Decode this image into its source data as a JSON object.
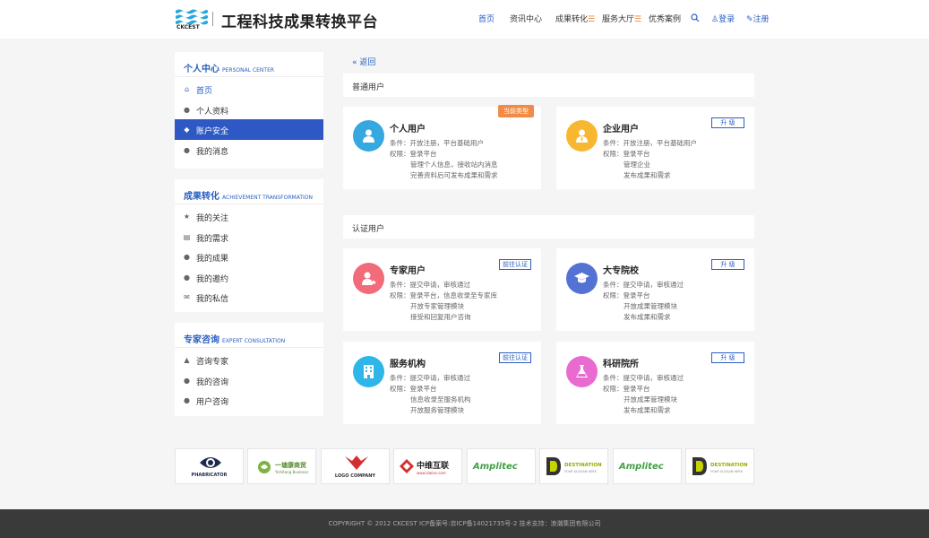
{
  "header": {
    "logo_text": "CKCEST",
    "site_title": "工程科技成果转换平台",
    "nav": {
      "home": "首页",
      "news": "资讯中心",
      "achievement": "成果转化",
      "service": "服务大厅",
      "cases": "优秀案例",
      "login": "登录",
      "register": "注册"
    }
  },
  "sidebar": {
    "personal": {
      "title": "个人中心",
      "subtitle": "PERSONAL CENTER",
      "items": [
        "首页",
        "个人资料",
        "账户安全",
        "我的消息"
      ]
    },
    "achievement": {
      "title": "成果转化",
      "subtitle": "ACHIEVEMENT TRANSFORMATION",
      "items": [
        "我的关注",
        "我的需求",
        "我的成果",
        "我的邀约",
        "我的私信"
      ]
    },
    "expert": {
      "title": "专家咨询",
      "subtitle": "EXPERT CONSULTATION",
      "items": [
        "咨询专家",
        "我的咨询",
        "用户咨询"
      ]
    }
  },
  "main": {
    "back": "返回",
    "regular_section": "普通用户",
    "certified_section": "认证用户",
    "cards": {
      "personal": {
        "title": "个人用户",
        "badge": "当前类型",
        "lines": [
          "条件：开放注册，平台基础用户",
          "权限：登录平台",
          "管理个人信息，接收站内消息",
          "完善资料后可发布成果和需求"
        ]
      },
      "enterprise": {
        "title": "企业用户",
        "button": "升 级",
        "lines": [
          "条件：开放注册，平台基础用户",
          "权限：登录平台",
          "管理企业",
          "发布成果和需求"
        ]
      },
      "expert": {
        "title": "专家用户",
        "button": "前往认证",
        "lines": [
          "条件：提交申请，审核通过",
          "权限：登录平台，信息收录至专家库",
          "开放专家管理模块",
          "接受和回复用户咨询"
        ]
      },
      "college": {
        "title": "大专院校",
        "button": "升 级",
        "lines": [
          "条件：提交申请，审核通过",
          "权限：登录平台",
          "开放成果管理模块",
          "发布成果和需求"
        ]
      },
      "service_org": {
        "title": "服务机构",
        "button": "前往认证",
        "lines": [
          "条件：提交申请，审核通过",
          "权限：登录平台",
          "信息收录至服务机构",
          "开放服务管理模块"
        ]
      },
      "research": {
        "title": "科研院所",
        "button": "升 级",
        "lines": [
          "条件：提交申请，审核通过",
          "权限：登录平台",
          "开放成果管理模块",
          "发布成果和需求"
        ]
      }
    }
  },
  "partners": {
    "phabricator": "PHABRICATOR",
    "yitang": "一塘康商贸",
    "yitang_sub": "Yishitang Business",
    "logo_company": "LOGO COMPANY",
    "zhongwei": "中维互联",
    "zhongwei_sub": "www.ziwise.com",
    "amplitec": "Amplitec",
    "destination": "DESTINATION",
    "destination_sub": "YOUR SLOGAN HERE"
  },
  "footer": {
    "text": "COPYRIGHT © 2012 CKCEST ICP备案号:京ICP备14021735号-2   技术支持：浪潮集团有限公司"
  },
  "colors": {
    "accent": "#2e58c4",
    "orange": "#f28b45",
    "blue_circle": "#35a8e0",
    "yellow_circle": "#f7b731",
    "red_circle": "#f16b7a",
    "indigo_circle": "#5472d3",
    "cyan_circle": "#2fb6e8",
    "pink_circle": "#e96bd0"
  }
}
